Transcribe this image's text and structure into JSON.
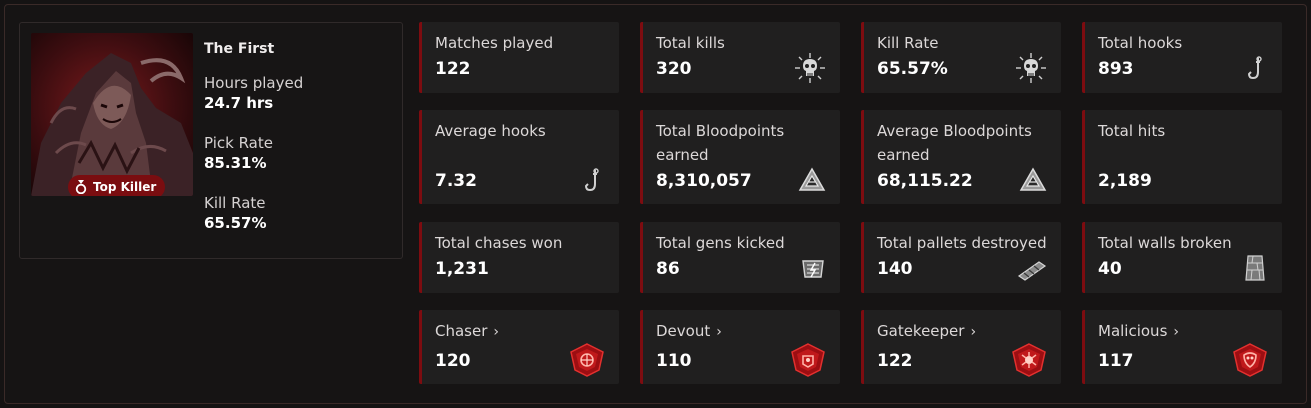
{
  "profile": {
    "name": "The First",
    "badge": "Top Killer",
    "stats": [
      {
        "label": "Hours played",
        "value": "24.7 hrs"
      },
      {
        "label": "Pick Rate",
        "value": "85.31%"
      },
      {
        "label": "Kill Rate",
        "value": "65.57%"
      }
    ]
  },
  "tiles": [
    {
      "label": "Matches played",
      "value": "122",
      "icon": "none"
    },
    {
      "label": "Total kills",
      "value": "320",
      "icon": "skull-icon"
    },
    {
      "label": "Kill Rate",
      "value": "65.57%",
      "icon": "skull-icon"
    },
    {
      "label": "Total hooks",
      "value": "893",
      "icon": "hook-icon"
    },
    {
      "label": "Average hooks",
      "value": "7.32",
      "icon": "hook-icon"
    },
    {
      "label": "Total Bloodpoints earned",
      "value": "8,310,057",
      "icon": "bloodpoints-icon"
    },
    {
      "label": "Average Bloodpoints earned",
      "value": "68,115.22",
      "icon": "bloodpoints-icon"
    },
    {
      "label": "Total hits",
      "value": "2,189",
      "icon": "none"
    },
    {
      "label": "Total chases won",
      "value": "1,231",
      "icon": "none"
    },
    {
      "label": "Total gens kicked",
      "value": "86",
      "icon": "generator-icon"
    },
    {
      "label": "Total pallets destroyed",
      "value": "140",
      "icon": "pallet-icon"
    },
    {
      "label": "Total walls broken",
      "value": "40",
      "icon": "wall-icon"
    },
    {
      "label": "Chaser",
      "value": "120",
      "icon": "emblem-icon"
    },
    {
      "label": "Devout",
      "value": "110",
      "icon": "emblem-icon"
    },
    {
      "label": "Gatekeeper",
      "value": "122",
      "icon": "emblem-icon"
    },
    {
      "label": "Malicious",
      "value": "117",
      "icon": "emblem-icon"
    }
  ],
  "colors": {
    "accent": "#7d0c10",
    "tile_bg": "#201f1f",
    "page_bg": "#151313"
  }
}
